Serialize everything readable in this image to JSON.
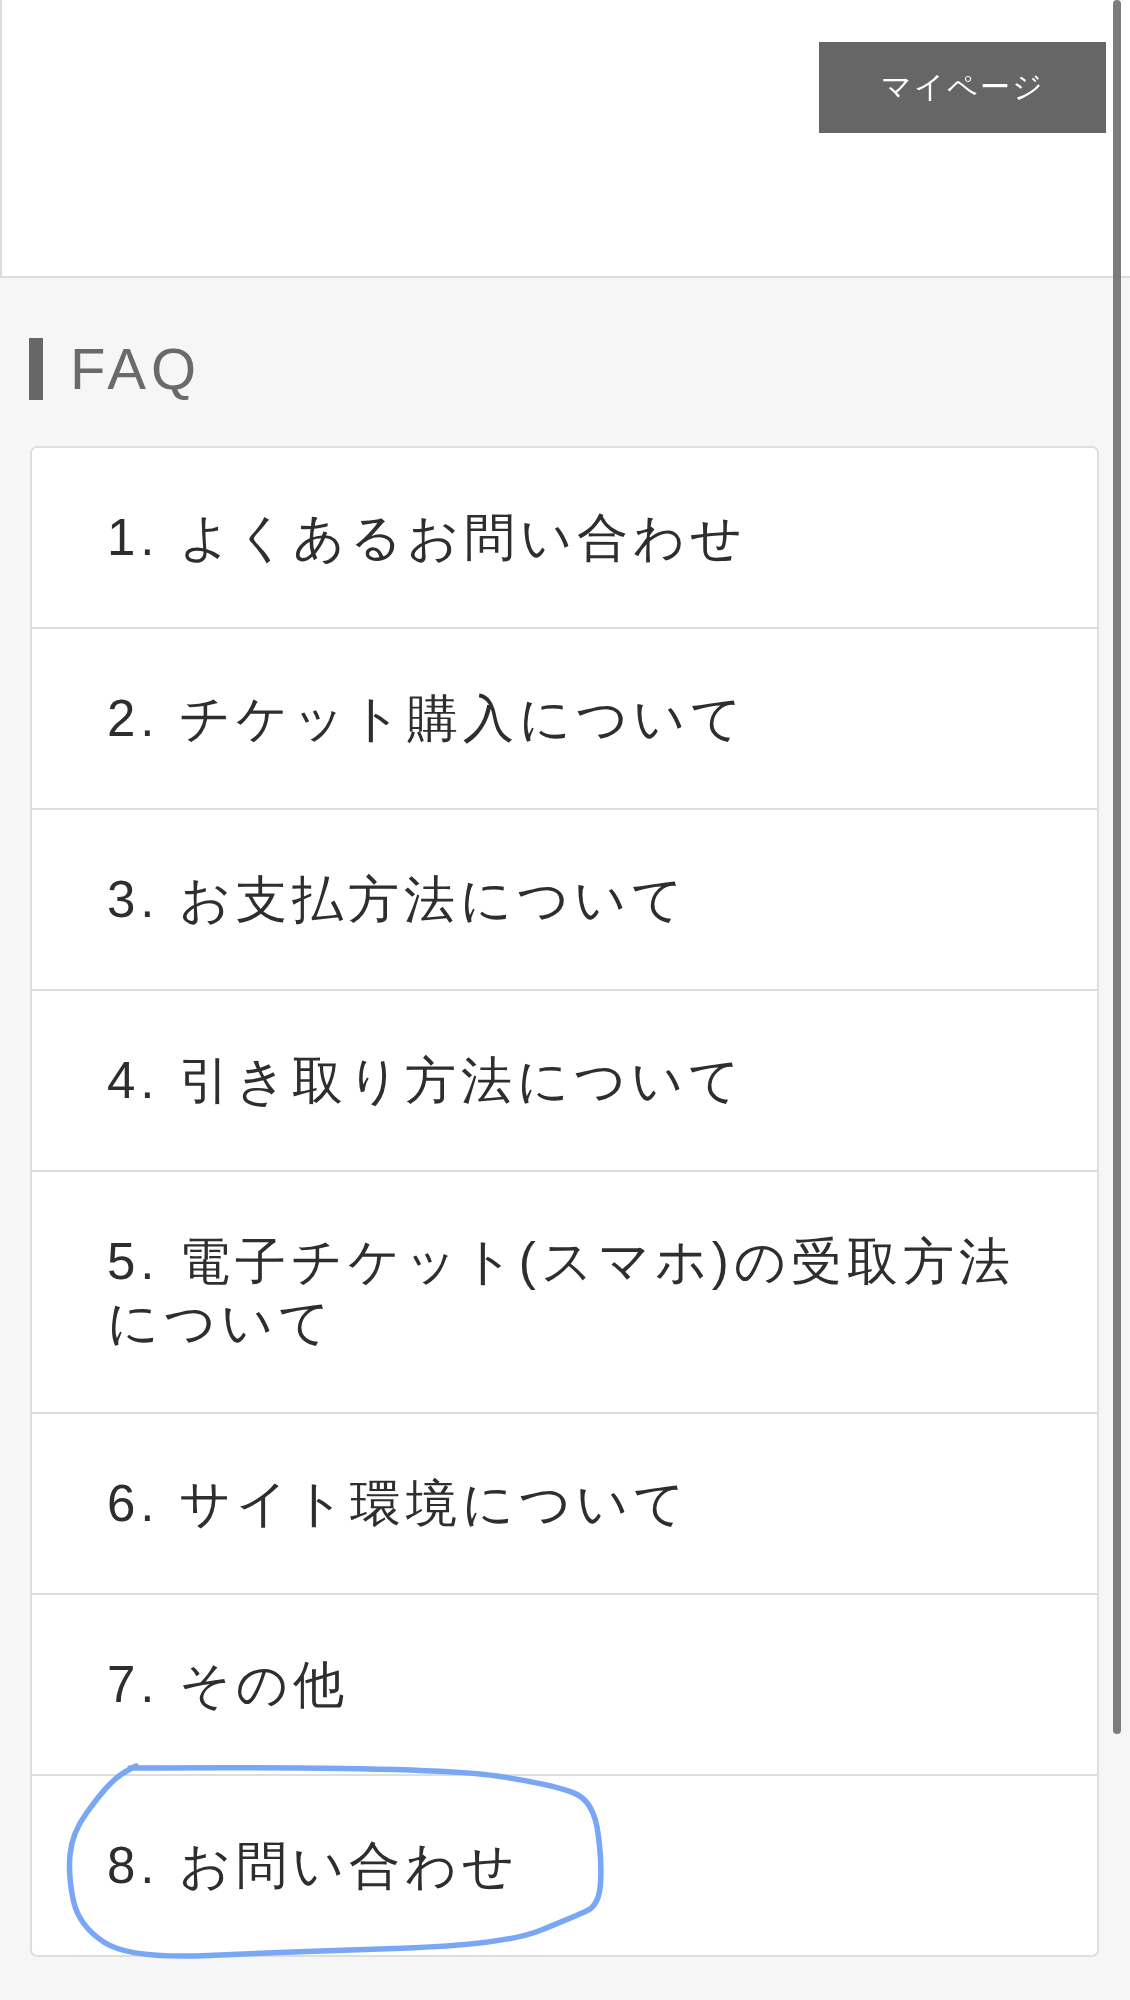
{
  "header": {
    "mypage_button": "マイページ"
  },
  "faq": {
    "title": "FAQ",
    "items": [
      {
        "label": "1. よくあるお問い合わせ",
        "circled": false
      },
      {
        "label": "2. チケット購入について",
        "circled": false
      },
      {
        "label": "3. お支払方法について",
        "circled": false
      },
      {
        "label": "4. 引き取り方法について",
        "circled": false
      },
      {
        "label": "5. 電子チケット(スマホ)の受取方法について",
        "circled": false
      },
      {
        "label": "6. サイト環境について",
        "circled": false
      },
      {
        "label": "7. その他",
        "circled": false
      },
      {
        "label": "8. お問い合わせ",
        "circled": true
      }
    ]
  }
}
